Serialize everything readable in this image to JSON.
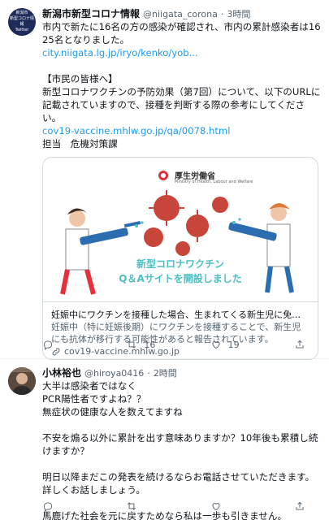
{
  "tweet1": {
    "avatar": {
      "line1": "新潟市",
      "line2": "新型コロナ情報",
      "line3": "Twitter"
    },
    "name": "新潟市新型コロナ情報",
    "handle": "@niigata_corona",
    "sep": "·",
    "time": "3時間",
    "text1": "市内で新たに16名の方の感染が確認され、市内の累計感染者は1625名となりました。",
    "link1": "city.niigata.lg.jp/iryo/kenko/yob...",
    "text2": "【市民の皆様へ】",
    "text3": "新型コロナワクチンの予防効果（第7回）について、以下のURLに記載されていますので、接種を判断する際の参考にしてください。",
    "link2": "cov19-vaccine.mhlw.go.jp/qa/0078.html",
    "text4": "担当　危機対策課",
    "card": {
      "ministry": "厚生労働省",
      "ministry_en": "Ministry of Health, Labour and Welfare",
      "banner_line1": "新型コロナワクチン",
      "banner_line2": "Q＆Aサイトを開設しました",
      "title": "妊娠中にワクチンを接種した場合、生まれてくる新生児に免疫はつき...",
      "desc": "妊娠中（特に妊娠後期）にワクチンを接種することで、新生児にも抗体が移行する可能性があると報告されています。",
      "domain": "cov19-vaccine.mhlw.go.jp"
    },
    "actions": {
      "retweets": "16",
      "likes": "19"
    }
  },
  "tweet2": {
    "name": "小林裕也",
    "handle": "@hiroya0416",
    "sep": "·",
    "time": "2時間",
    "lines": [
      "大半は感染者ではなく",
      "PCR陽性者ですよね？？",
      "無症状の健康な人を数えてますね",
      "",
      "不安を煽る以外に累計を出す意味ありますか？10年後も累積し続けますか？",
      "",
      "明日以降まだこの発表を続けるならお電話させていただきます。詳しくお話しましょう。",
      "",
      "馬鹿げた社会を元に戻すためなら私は一歩も引きません。"
    ]
  },
  "colors": {
    "link": "#1d9bf0",
    "muted": "#536471",
    "virus": "#c8453a",
    "banner": "#4bbfc3"
  }
}
